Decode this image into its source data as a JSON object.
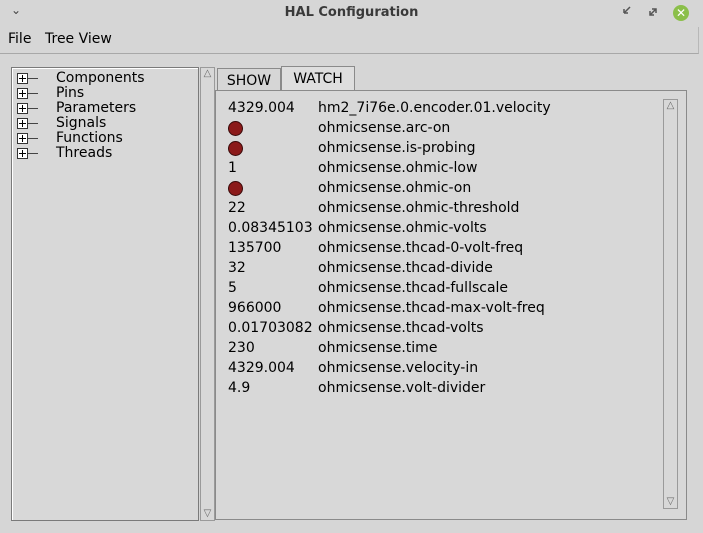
{
  "window": {
    "title": "HAL Configuration",
    "chevron_icon": "chevron-down-icon",
    "close_glyph": "✕",
    "close_color": "#8bbf4a"
  },
  "menu": {
    "file": "File",
    "tree_view": "Tree View"
  },
  "tree": {
    "items": [
      {
        "label": "Components"
      },
      {
        "label": "Pins"
      },
      {
        "label": "Parameters"
      },
      {
        "label": "Signals"
      },
      {
        "label": "Functions"
      },
      {
        "label": "Threads"
      }
    ]
  },
  "tabs": {
    "show": "SHOW",
    "watch": "WATCH",
    "active": "WATCH"
  },
  "watch": {
    "led_color": "#8b1a1a",
    "rows": [
      {
        "value": "4329.004",
        "name": "hm2_7i76e.0.encoder.01.velocity"
      },
      {
        "value": "",
        "led": true,
        "name": "ohmicsense.arc-on"
      },
      {
        "value": "",
        "led": true,
        "name": "ohmicsense.is-probing"
      },
      {
        "value": "1",
        "name": "ohmicsense.ohmic-low"
      },
      {
        "value": "",
        "led": true,
        "name": "ohmicsense.ohmic-on"
      },
      {
        "value": "22",
        "name": "ohmicsense.ohmic-threshold"
      },
      {
        "value": "0.08345103",
        "name": "ohmicsense.ohmic-volts"
      },
      {
        "value": "135700",
        "name": "ohmicsense.thcad-0-volt-freq"
      },
      {
        "value": "32",
        "name": "ohmicsense.thcad-divide"
      },
      {
        "value": "5",
        "name": "ohmicsense.thcad-fullscale"
      },
      {
        "value": "966000",
        "name": "ohmicsense.thcad-max-volt-freq"
      },
      {
        "value": "0.01703082",
        "name": "ohmicsense.thcad-volts"
      },
      {
        "value": "230",
        "name": "ohmicsense.time"
      },
      {
        "value": "4329.004",
        "name": "ohmicsense.velocity-in"
      },
      {
        "value": "4.9",
        "name": "ohmicsense.volt-divider"
      }
    ]
  }
}
